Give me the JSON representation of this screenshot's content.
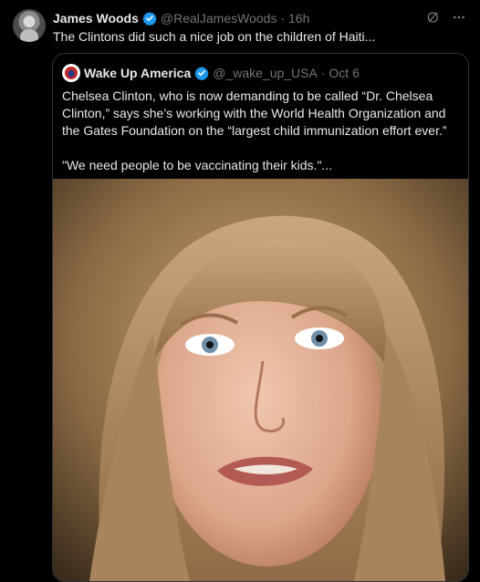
{
  "tweet": {
    "author_name": "James Woods",
    "author_handle": "@RealJamesWoods",
    "time": "· 16h",
    "text": "The Clintons did such a nice job on the children of Haiti..."
  },
  "quote": {
    "author_name": "Wake Up America",
    "author_handle": "@_wake_up_USA",
    "time": "· Oct 6",
    "paragraph1": "Chelsea Clinton, who is now demanding to be called “Dr. Chelsea Clinton,” says she’s working with the World Health Organization and the Gates Foundation on the “largest child immunization effort ever.”",
    "paragraph2": "\"We need people to be vaccinating their kids.\"..."
  },
  "icons": {
    "verified": "verified-badge-icon",
    "grok": "grok-icon",
    "more": "more-icon"
  },
  "colors": {
    "background": "#000000",
    "text": "#e7e9ea",
    "muted": "#71767b",
    "verified": "#1d9bf0",
    "border": "#2f3336"
  }
}
